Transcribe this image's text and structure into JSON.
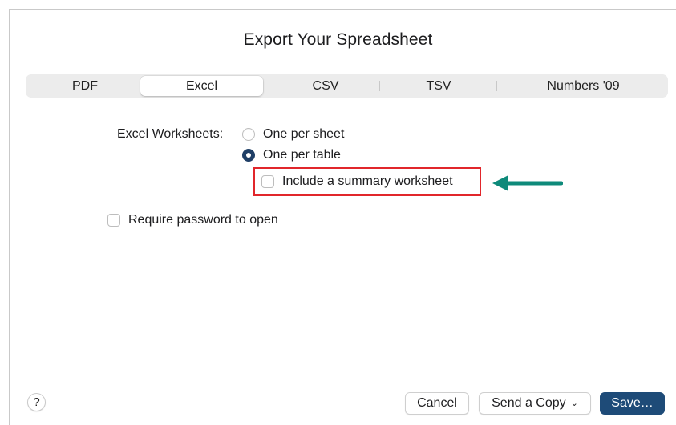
{
  "dialog": {
    "title": "Export Your Spreadsheet"
  },
  "tabs": [
    {
      "label": "PDF",
      "selected": false
    },
    {
      "label": "Excel",
      "selected": true
    },
    {
      "label": "CSV",
      "selected": false
    },
    {
      "label": "TSV",
      "selected": false
    },
    {
      "label": "Numbers '09",
      "selected": false
    }
  ],
  "excel_options": {
    "worksheets_label": "Excel Worksheets:",
    "radio_one_per_sheet": {
      "label": "One per sheet",
      "checked": false
    },
    "radio_one_per_table": {
      "label": "One per table",
      "checked": true
    },
    "summary_checkbox": {
      "label": "Include a summary worksheet",
      "checked": false
    },
    "password_checkbox": {
      "label": "Require password to open",
      "checked": false
    }
  },
  "annotation": {
    "highlight_color": "#e1262b",
    "arrow_color": "#0e8a7a"
  },
  "footer": {
    "help_label": "?",
    "cancel_label": "Cancel",
    "send_copy_label": "Send a Copy",
    "save_label": "Save…"
  },
  "colors": {
    "accent": "#1e4b78",
    "radio_selected": "#1f3f66"
  }
}
